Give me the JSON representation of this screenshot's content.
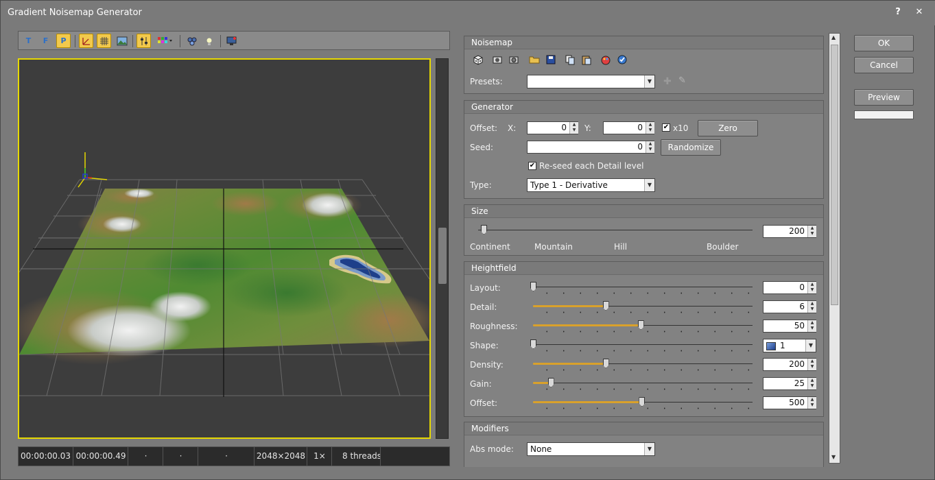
{
  "window": {
    "title": "Gradient Noisemap Generator",
    "help_glyph": "?",
    "close_glyph": "✕"
  },
  "toolbar": {
    "tools": [
      {
        "name": "top-view-icon",
        "glyph": "T",
        "on": false
      },
      {
        "name": "front-view-icon",
        "glyph": "F",
        "on": false
      },
      {
        "name": "perspective-view-icon",
        "glyph": "P",
        "on": true
      },
      {
        "name": "axes-icon",
        "glyph": "⟀",
        "on": true
      },
      {
        "name": "grid-icon",
        "glyph": "▦",
        "on": true
      },
      {
        "name": "image-icon",
        "glyph": "▨",
        "on": false
      },
      {
        "name": "adjust-icon",
        "glyph": "⊞",
        "on": true
      },
      {
        "name": "palette-icon",
        "glyph": "▚",
        "on": false
      },
      {
        "name": "render-icon",
        "glyph": "⚙",
        "on": false
      },
      {
        "name": "light-icon",
        "glyph": "☀",
        "on": false
      },
      {
        "name": "monitor-icon",
        "glyph": "▣",
        "on": false
      }
    ]
  },
  "statusbar": {
    "time1": "00:00:00.03",
    "time2": "00:00:00.49",
    "dot1": "·",
    "dot2": "·",
    "dot3": "·",
    "resolution": "2048×2048",
    "zoom": "1×",
    "threads": "8 threads"
  },
  "noisemap": {
    "header": "Noisemap",
    "icons": [
      "dice-icon",
      "camera-icon",
      "camera-settings-icon",
      "folder-open-icon",
      "save-icon",
      "copy-icon",
      "paste-icon",
      "palette-icon",
      "check-icon"
    ],
    "presets_label": "Presets:",
    "presets_value": ""
  },
  "generator": {
    "header": "Generator",
    "offset_label": "Offset:",
    "x_label": "X:",
    "x_value": "0",
    "y_label": "Y:",
    "y_value": "0",
    "x10_label": "x10",
    "x10_checked": true,
    "zero_label": "Zero",
    "seed_label": "Seed:",
    "seed_value": "0",
    "randomize_label": "Randomize",
    "reseed_label": "Re-seed each Detail level",
    "reseed_checked": true,
    "type_label": "Type:",
    "type_value": "Type 1 - Derivative"
  },
  "size": {
    "header": "Size",
    "value": "200",
    "slider_level": 0.02,
    "marks": [
      "Continent",
      "Mountain",
      "Hill",
      "Boulder"
    ]
  },
  "heightfield": {
    "header": "Heightfield",
    "rows": [
      {
        "label": "Layout:",
        "value": "0",
        "level": 0.0,
        "filled": false
      },
      {
        "label": "Detail:",
        "value": "6",
        "level": 0.33,
        "filled": true
      },
      {
        "label": "Roughness:",
        "value": "50",
        "level": 0.49,
        "filled": true
      },
      {
        "label": "Shape:",
        "value": "1",
        "level": 0.0,
        "filled": false,
        "combo": true
      },
      {
        "label": "Density:",
        "value": "200",
        "level": 0.33,
        "filled": true
      },
      {
        "label": "Gain:",
        "value": "25",
        "level": 0.08,
        "filled": true
      },
      {
        "label": "Offset:",
        "value": "500",
        "level": 0.495,
        "filled": true
      }
    ]
  },
  "modifiers": {
    "header": "Modifiers",
    "abs_label": "Abs mode:",
    "abs_value": "None"
  },
  "actions": {
    "ok": "OK",
    "cancel": "Cancel",
    "preview": "Preview"
  },
  "colors": {
    "accent": "#e6d800",
    "slider_fill": "#d9a12b",
    "active_tool": "#f2c94c"
  }
}
